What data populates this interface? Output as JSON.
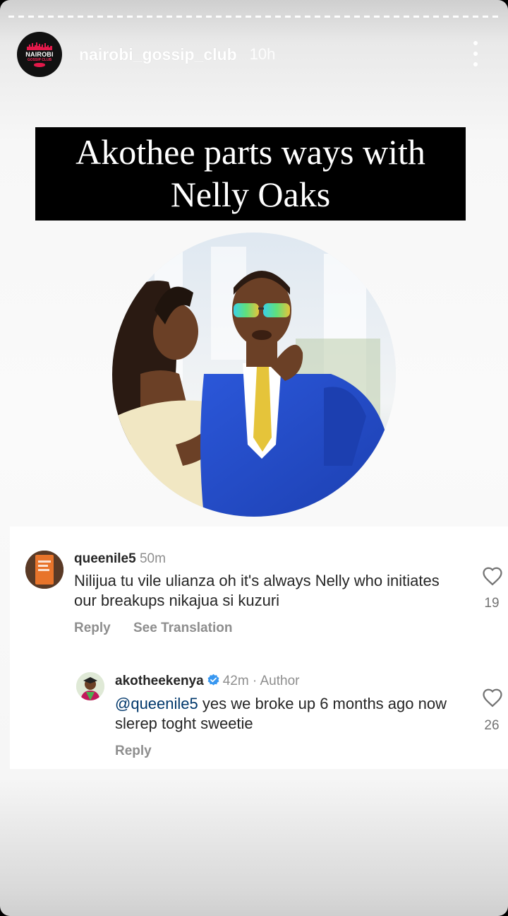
{
  "story": {
    "account": "nairobi_gossip_club",
    "age": "10h",
    "avatar_brand": "NAIROBI",
    "avatar_sub": "GOSSIP CLUB",
    "headline_line1": "Akothee parts ways with",
    "headline_line2": "Nelly Oaks"
  },
  "comments": [
    {
      "username": "queenile5",
      "time": "50m",
      "text": "Nilijua tu vile ulianza oh it's always Nelly who initiates our breakups nikajua si kuzuri",
      "likes": "19",
      "reply_label": "Reply",
      "translate_label": "See Translation"
    },
    {
      "username": "akotheekenya",
      "time": "42m",
      "role": "Author",
      "mention": "@queenile5",
      "text": " yes we broke up 6 months ago now slerep toght sweetie",
      "likes": "26",
      "reply_label": "Reply"
    }
  ],
  "colors": {
    "verified": "#3897f0",
    "mention": "#00376b",
    "muted": "#8e8e8e"
  },
  "icons": [
    "more-options-icon",
    "heart-icon",
    "verified-badge-icon"
  ]
}
